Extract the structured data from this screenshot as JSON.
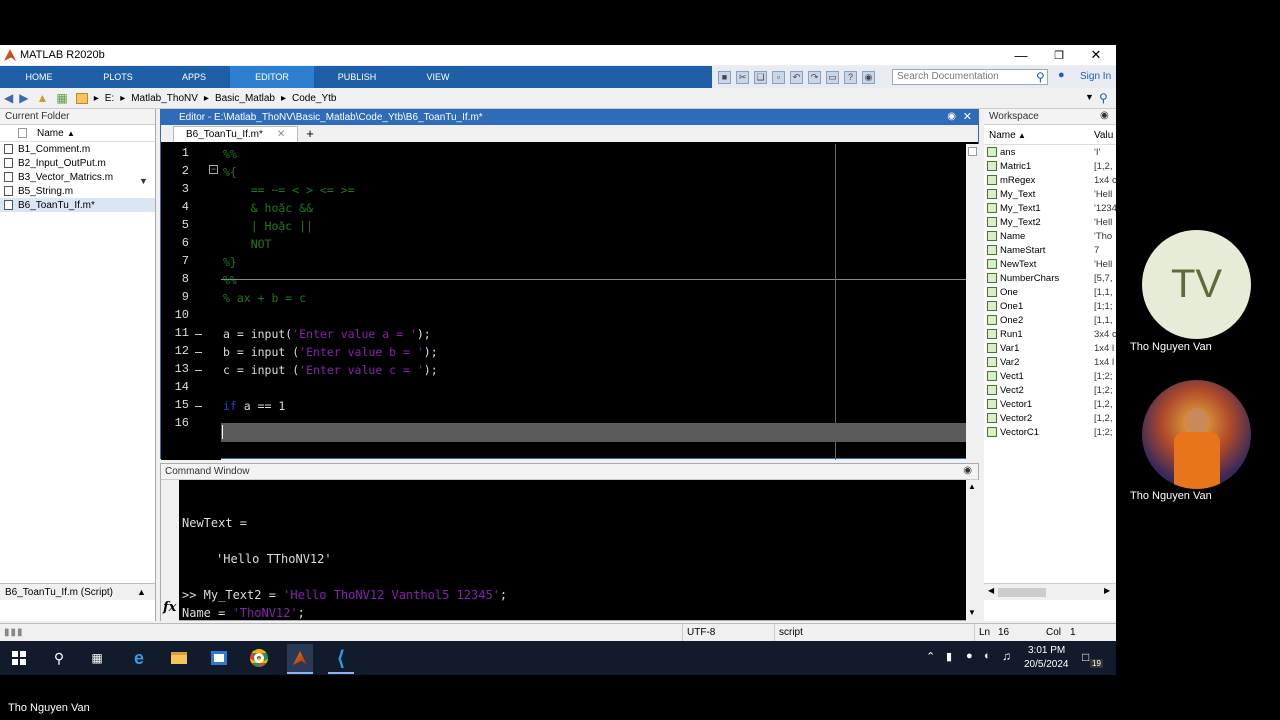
{
  "window": {
    "title": "MATLAB R2020b"
  },
  "ribbon": {
    "tabs": [
      "HOME",
      "PLOTS",
      "APPS",
      "EDITOR",
      "PUBLISH",
      "VIEW"
    ],
    "active_tab": "EDITOR",
    "search_placeholder": "Search Documentation",
    "sign_in": "Sign In"
  },
  "address": {
    "crumbs": [
      "E:",
      "Matlab_ThoNV",
      "Basic_Matlab",
      "Code_Ytb"
    ]
  },
  "current_folder": {
    "title": "Current Folder",
    "column": "Name",
    "files": [
      "B1_Comment.m",
      "B2_Input_OutPut.m",
      "B3_Vector_Matrics.m",
      "B5_String.m",
      "B6_ToanTu_If.m*"
    ],
    "selected_index": 4,
    "details": "B6_ToanTu_If.m (Script)"
  },
  "editor": {
    "title": "Editor - E:\\Matlab_ThoNV\\Basic_Matlab\\Code_Ytb\\B6_ToanTu_If.m*",
    "tab": "B6_ToanTu_If.m*",
    "line_numbers": [
      "1",
      "2",
      "3",
      "4",
      "5",
      "6",
      "7",
      "8",
      "9",
      "10",
      "11",
      "12",
      "13",
      "14",
      "15",
      "16"
    ],
    "lines": [
      {
        "n": "1",
        "parts": [
          [
            "cmt",
            "%%"
          ]
        ]
      },
      {
        "n": "2",
        "parts": [
          [
            "cmt",
            "%{"
          ]
        ]
      },
      {
        "n": "3",
        "parts": [
          [
            "cmt",
            "    == ~= < > <= >="
          ]
        ]
      },
      {
        "n": "4",
        "parts": [
          [
            "cmt",
            "    & hoặc &&"
          ]
        ]
      },
      {
        "n": "5",
        "parts": [
          [
            "cmt",
            "    | Hoặc ||"
          ]
        ]
      },
      {
        "n": "6",
        "parts": [
          [
            "cmt",
            "    NOT"
          ]
        ]
      },
      {
        "n": "7",
        "parts": [
          [
            "cmt",
            "%}"
          ]
        ]
      },
      {
        "n": "8",
        "parts": [
          [
            "cmt",
            "%%"
          ]
        ]
      },
      {
        "n": "9",
        "parts": [
          [
            "cmt",
            "% ax + b = c"
          ]
        ]
      },
      {
        "n": "10",
        "parts": []
      },
      {
        "n": "11",
        "parts": [
          [
            "txt",
            "a = input("
          ],
          [
            "str",
            "'Enter value a = '"
          ],
          [
            "txt",
            ");"
          ]
        ]
      },
      {
        "n": "12",
        "parts": [
          [
            "txt",
            "b = input ("
          ],
          [
            "str",
            "'Enter value b = '"
          ],
          [
            "txt",
            ");"
          ]
        ]
      },
      {
        "n": "13",
        "parts": [
          [
            "txt",
            "c = input ("
          ],
          [
            "str",
            "'Enter value c = '"
          ],
          [
            "txt",
            ");"
          ]
        ]
      },
      {
        "n": "14",
        "parts": []
      },
      {
        "n": "15",
        "parts": [
          [
            "kw",
            "if"
          ],
          [
            "txt",
            " a == 1"
          ]
        ]
      },
      {
        "n": "16",
        "parts": []
      }
    ]
  },
  "command_window": {
    "title": "Command Window",
    "output_var": "NewText =",
    "output_value": "'Hello TThoNV12'",
    "cmd1_prefix": ">> My_Text2 = ",
    "cmd1_string": "'Hello ThoNV12 Vanthol5 12345'",
    "cmd1_suffix": ";",
    "cmd2_prefix": "Name = ",
    "cmd2_string": "'ThoNV12'",
    "cmd2_suffix": ";",
    "fx": "fx"
  },
  "workspace": {
    "title": "Workspace",
    "col_name": "Name",
    "col_value": "Valu",
    "vars": [
      {
        "name": "ans",
        "value": "'I'"
      },
      {
        "name": "Matric1",
        "value": "[1,2,"
      },
      {
        "name": "mRegex",
        "value": "1x4 c"
      },
      {
        "name": "My_Text",
        "value": "'Hell"
      },
      {
        "name": "My_Text1",
        "value": "'1234"
      },
      {
        "name": "My_Text2",
        "value": "'Hell"
      },
      {
        "name": "Name",
        "value": "'Tho"
      },
      {
        "name": "NameStart",
        "value": "7"
      },
      {
        "name": "NewText",
        "value": "'Hell"
      },
      {
        "name": "NumberChars",
        "value": "[5,7,"
      },
      {
        "name": "One",
        "value": "[1,1,"
      },
      {
        "name": "One1",
        "value": "[1;1;"
      },
      {
        "name": "One2",
        "value": "[1,1,"
      },
      {
        "name": "Run1",
        "value": "3x4 c"
      },
      {
        "name": "Var1",
        "value": "1x4 l"
      },
      {
        "name": "Var2",
        "value": "1x4 l"
      },
      {
        "name": "Vect1",
        "value": "[1;2;"
      },
      {
        "name": "Vect2",
        "value": "[1;2;"
      },
      {
        "name": "Vector1",
        "value": "[1,2,"
      },
      {
        "name": "Vector2",
        "value": "[1,2,"
      },
      {
        "name": "VectorC1",
        "value": "[1;2;"
      }
    ]
  },
  "status": {
    "encoding": "UTF-8",
    "type": "script",
    "ln_label": "Ln",
    "ln": "16",
    "col_label": "Col",
    "col": "1"
  },
  "taskbar": {
    "time": "3:01 PM",
    "date": "20/5/2024",
    "notif": "19"
  },
  "meeting": {
    "initials": "TV",
    "participant1": "Tho Nguyen Van",
    "participant2": "Tho Nguyen Van",
    "presenter": "Tho Nguyen Van"
  },
  "colors": {
    "ribbon": "#1e5fa8",
    "active_tab": "#2f7fd0",
    "editor_title": "#2e6bb8",
    "avatar_bg": "#e7ecd9",
    "avatar_text": "#5d6a3a"
  }
}
